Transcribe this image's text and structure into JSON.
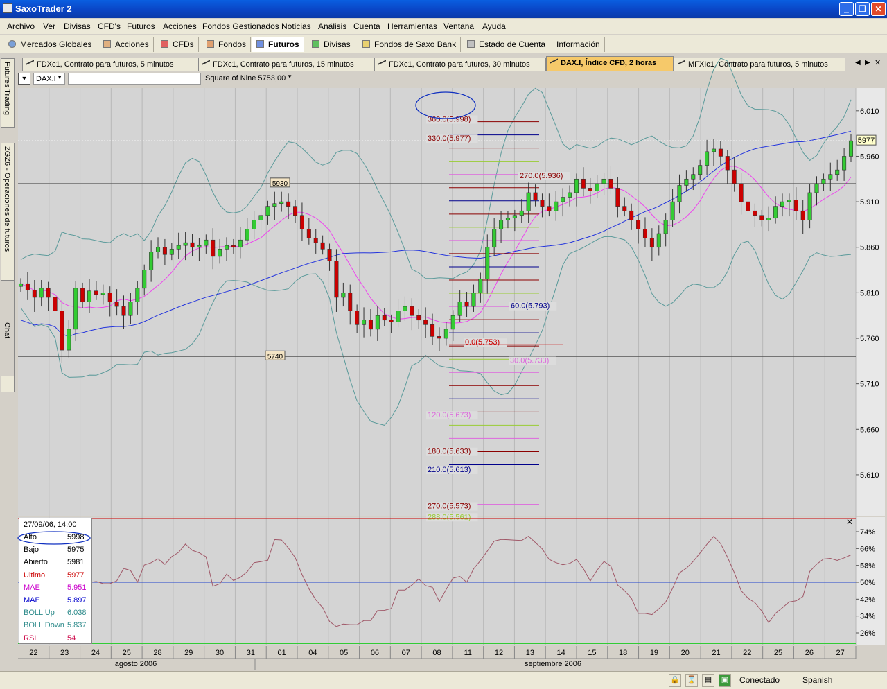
{
  "window": {
    "title": "SaxoTrader 2",
    "minimize": "_",
    "maximize": "❐",
    "close": "✕"
  },
  "menu": [
    "Archivo",
    "Ver",
    "Divisas",
    "CFD's",
    "Futuros",
    "Acciones",
    "Fondos Gestionados",
    "Noticias",
    "Análisis",
    "Cuenta",
    "Herramientas",
    "Ventana",
    "Ayuda"
  ],
  "toolbar": [
    "Mercados Globales",
    "Acciones",
    "CFDs",
    "Fondos",
    "Futuros",
    "Divisas",
    "Fondos de Saxo Bank",
    "Estado de Cuenta",
    "Información"
  ],
  "side_tabs": [
    "Futures Trading",
    "ZGZ6 - Operaciones de futuros",
    "Chat"
  ],
  "chart_tabs": [
    "FDXc1, Contrato para futuros, 5 minutos",
    "FDXc1, Contrato para futuros, 15 minutos",
    "FDXc1, Contrato para futuros, 30 minutos",
    "DAX.I, Índice CFD, 2 horas",
    "MFXIc1, Contrato para futuros, 5 minutos"
  ],
  "chart_header": {
    "symbol": "DAX.I",
    "search_value": "",
    "indicator": "Square of Nine 5753,00"
  },
  "info_box": {
    "datetime": "27/09/06, 14:00",
    "rows": [
      {
        "label": "Alto",
        "value": "5998",
        "color": "#000000"
      },
      {
        "label": "Bajo",
        "value": "5975",
        "color": "#000000"
      },
      {
        "label": "Abierto",
        "value": "5981",
        "color": "#000000"
      },
      {
        "label": "Ultimo",
        "value": "5977",
        "color": "#cc0000"
      },
      {
        "label": "MAE",
        "value": "5.951",
        "color": "#cc00cc"
      },
      {
        "label": "MAE",
        "value": "5.897",
        "color": "#0000cc"
      },
      {
        "label": "BOLL Up",
        "value": "6.038",
        "color": "#2e8b8b"
      },
      {
        "label": "BOLL Down",
        "value": "5.837",
        "color": "#2e8b8b"
      },
      {
        "label": "RSI",
        "value": "54",
        "color": "#cc0044"
      }
    ]
  },
  "status": {
    "connection": "Conectado",
    "language": "Spanish"
  },
  "months": [
    "agosto 2006",
    "septiembre 2006"
  ],
  "chart_data": {
    "type": "candlestick",
    "price_axis": {
      "ticks": [
        "6.010",
        "5.960",
        "5.910",
        "5.860",
        "5.810",
        "5.760",
        "5.710",
        "5.660",
        "5.610"
      ],
      "range": [
        5565,
        6035
      ]
    },
    "last_price_tag": "5977",
    "x_dates": [
      "22",
      "23",
      "24",
      "25",
      "28",
      "29",
      "30",
      "31",
      "01",
      "04",
      "05",
      "06",
      "07",
      "08",
      "11",
      "12",
      "13",
      "14",
      "15",
      "18",
      "19",
      "20",
      "21",
      "22",
      "25",
      "26",
      "27"
    ],
    "horizontal_lines": [
      {
        "label": "5930",
        "value": 5930
      },
      {
        "label": "5740",
        "value": 5740
      }
    ],
    "square_of_nine_levels": [
      {
        "label": "360.0(5.998)",
        "value": 5998,
        "color": "#8b0000"
      },
      {
        "label": "330.0(5.977)",
        "value": 5977,
        "color": "#8b0000"
      },
      {
        "label": "270.0(5.936)",
        "value": 5936,
        "color": "#8b0000"
      },
      {
        "label": "60.0(5.793)",
        "value": 5793,
        "color": "#00008b"
      },
      {
        "label": "0.0(5.753)",
        "value": 5753,
        "color": "#cc0000"
      },
      {
        "label": "30.0(5.733)",
        "value": 5733,
        "color": "#dd66dd"
      },
      {
        "label": "120.0(5.673)",
        "value": 5673,
        "color": "#dd66dd"
      },
      {
        "label": "180.0(5.633)",
        "value": 5633,
        "color": "#8b0000"
      },
      {
        "label": "210.0(5.613)",
        "value": 5613,
        "color": "#00008b"
      },
      {
        "label": "270.0(5.573)",
        "value": 5573,
        "color": "#8b0000"
      },
      {
        "label": "288.0(5.561)",
        "value": 5561,
        "color": "#99cc33"
      }
    ],
    "close_series": [
      5820,
      5813,
      5805,
      5815,
      5805,
      5790,
      5747,
      5770,
      5815,
      5800,
      5812,
      5808,
      5810,
      5800,
      5795,
      5785,
      5800,
      5815,
      5835,
      5855,
      5860,
      5852,
      5858,
      5862,
      5865,
      5860,
      5862,
      5868,
      5850,
      5858,
      5862,
      5860,
      5868,
      5880,
      5890,
      5895,
      5905,
      5908,
      5910,
      5905,
      5895,
      5880,
      5870,
      5865,
      5858,
      5845,
      5805,
      5810,
      5790,
      5775,
      5780,
      5770,
      5785,
      5780,
      5778,
      5790,
      5795,
      5785,
      5780,
      5775,
      5762,
      5760,
      5770,
      5785,
      5800,
      5795,
      5810,
      5825,
      5860,
      5880,
      5890,
      5892,
      5895,
      5900,
      5920,
      5912,
      5905,
      5900,
      5910,
      5915,
      5920,
      5935,
      5925,
      5922,
      5930,
      5935,
      5925,
      5905,
      5900,
      5890,
      5880,
      5870,
      5860,
      5875,
      5890,
      5910,
      5928,
      5935,
      5940,
      5950,
      5965,
      5968,
      5960,
      5945,
      5930,
      5910,
      5900,
      5895,
      5890,
      5892,
      5905,
      5910,
      5912,
      5900,
      5890,
      5920,
      5930,
      5935,
      5940,
      5945,
      5960,
      5977
    ],
    "rsi": {
      "ticks": [
        "74%",
        "66%",
        "58%",
        "50%",
        "42%",
        "34%",
        "26%"
      ],
      "level": 50
    }
  }
}
